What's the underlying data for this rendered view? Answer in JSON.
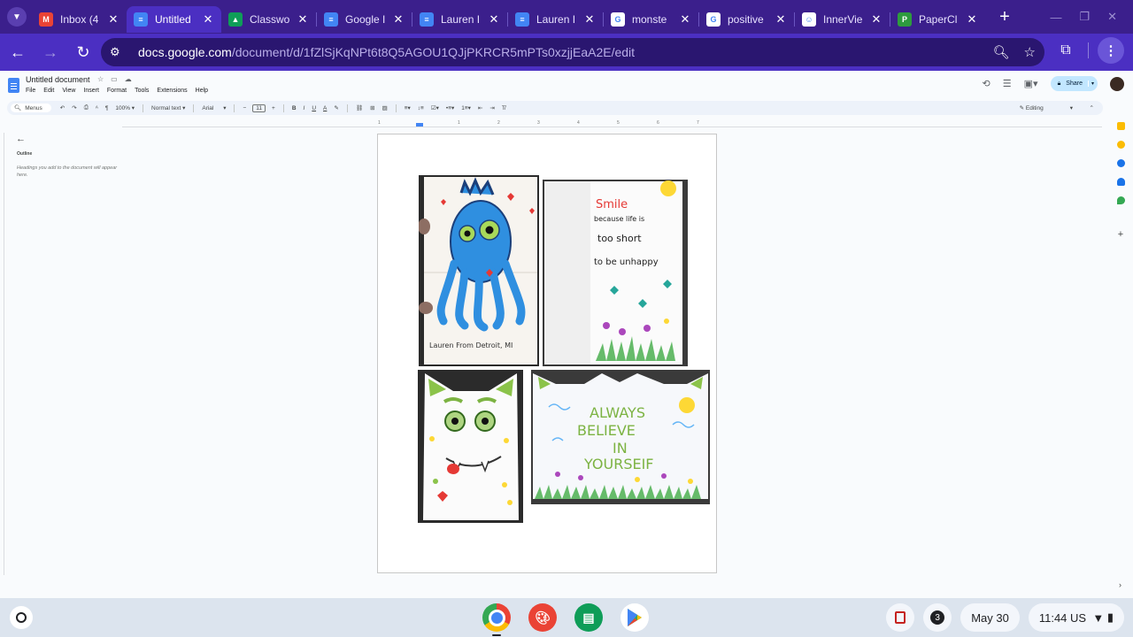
{
  "browser": {
    "tabs": [
      {
        "title": "Inbox (4",
        "icon": "gmail-icon",
        "color": "#ea4335",
        "glyph": "M"
      },
      {
        "title": "Untitled",
        "icon": "docs-icon",
        "color": "#4285f4",
        "glyph": "≡",
        "active": true
      },
      {
        "title": "Classwo",
        "icon": "classroom-icon",
        "color": "#0f9d58",
        "glyph": "▲"
      },
      {
        "title": "Google I",
        "icon": "docs-icon",
        "color": "#4285f4",
        "glyph": "≡"
      },
      {
        "title": "Lauren I",
        "icon": "docs-icon",
        "color": "#4285f4",
        "glyph": "≡"
      },
      {
        "title": "Lauren I",
        "icon": "docs-icon",
        "color": "#4285f4",
        "glyph": "≡"
      },
      {
        "title": "monste",
        "icon": "google-icon",
        "color": "#ffffff",
        "glyph": "G"
      },
      {
        "title": "positive",
        "icon": "google-icon",
        "color": "#ffffff",
        "glyph": "G"
      },
      {
        "title": "InnerVie",
        "icon": "innerview-icon",
        "color": "#ffffff",
        "glyph": "☺"
      },
      {
        "title": "PaperCl",
        "icon": "papercut-icon",
        "color": "#2e9b3e",
        "glyph": "P"
      }
    ],
    "close_glyph": "✕",
    "new_tab_glyph": "+",
    "url_domain": "docs.google.com",
    "url_path": "/document/d/1fZlSjKqNPt6t8Q5AGOU1QJjPKRCR5mPTs0xzjjEaA2E/edit"
  },
  "docs": {
    "title": "Untitled document",
    "menus": [
      "File",
      "Edit",
      "View",
      "Insert",
      "Format",
      "Tools",
      "Extensions",
      "Help"
    ],
    "share_label": "Share",
    "toolbar": {
      "menus_label": "Menus",
      "zoom": "100%",
      "style": "Normal text",
      "font": "Arial",
      "font_size": "11",
      "mode": "Editing"
    },
    "ruler_ticks": [
      "1",
      "1",
      "2",
      "3",
      "4",
      "5",
      "6",
      "7"
    ],
    "outline": {
      "label": "Outline",
      "hint": "Headings you add to the document will appear here."
    },
    "images": [
      {
        "name": "monster-card-front-image",
        "caption": "Lauren From Detroit, MI"
      },
      {
        "name": "smile-card-inside-image",
        "lines": [
          "Smile",
          "because life is",
          "too short",
          "to be unhappy"
        ]
      },
      {
        "name": "cat-monster-card-image"
      },
      {
        "name": "believe-card-image",
        "lines": [
          "ALWAYS",
          "BELIEVE",
          "IN",
          "YOURSEIF"
        ]
      }
    ]
  },
  "shelf": {
    "notification_count": "3",
    "date": "May 30",
    "time": "11:44",
    "locale": "US"
  },
  "colors": {
    "chrome_frame": "#3b1f8c",
    "chrome_toolbar": "#4b2fc2",
    "omnibox": "#2a1670",
    "docs_bg": "#f9fbfd",
    "share_bg": "#c2e7ff"
  }
}
